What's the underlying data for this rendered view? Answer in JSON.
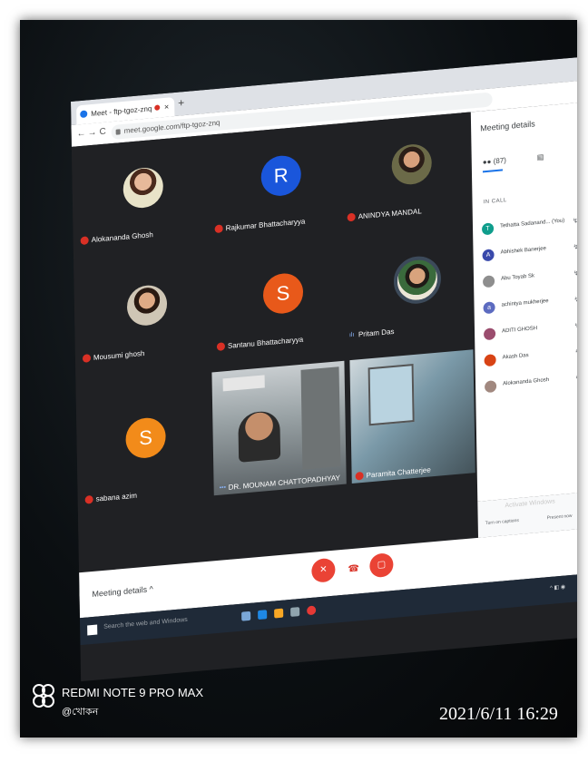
{
  "browser": {
    "tab_title": "Meet - ftp-tgoz-znq",
    "tab_close": "×",
    "new_tab": "+",
    "url": "meet.google.com/ftp-tgoz-znq",
    "nav_back": "←",
    "nav_forward": "→",
    "nav_reload": "C"
  },
  "tiles": [
    {
      "name": "Alokananda Ghosh",
      "type": "photo"
    },
    {
      "name": "Rajkumar Bhattacharyya",
      "type": "letter",
      "letter": "R",
      "color": "#1a56db"
    },
    {
      "name": "ANINDYA MANDAL",
      "type": "photo"
    },
    {
      "name": "Mousumi ghosh",
      "type": "photo"
    },
    {
      "name": "Santanu Bhattacharyya",
      "type": "letter",
      "letter": "S",
      "color": "#e8591a"
    },
    {
      "name": "Pritam Das",
      "type": "photo"
    },
    {
      "name": "sabana azim",
      "type": "letter",
      "letter": "S",
      "color": "#f28b1a"
    },
    {
      "name": "DR. MOUNAM CHATTOPADHYAY",
      "type": "video"
    },
    {
      "name": "Paramita Chatterjee",
      "type": "video"
    }
  ],
  "panel": {
    "title": "Meeting details",
    "people_count": "(87)",
    "section": "IN CALL",
    "participants": [
      {
        "name": "Tethatta Sadanand... (You)",
        "initial": "T",
        "color": "#0f9d8c"
      },
      {
        "name": "Abhishek Banerjee",
        "initial": "A",
        "color": "#3949ab"
      },
      {
        "name": "Abu Toyab Sk",
        "initial": "",
        "color": "#8e8e8e"
      },
      {
        "name": "achintya mukherjee",
        "initial": "a",
        "color": "#5c6bc0"
      },
      {
        "name": "ADITI GHOSH",
        "initial": "",
        "color": "#9b4d6e"
      },
      {
        "name": "Akash Das",
        "initial": "",
        "color": "#d84315"
      },
      {
        "name": "Alokananda Ghosh",
        "initial": "",
        "color": "#a1887f"
      }
    ],
    "activate_text": "Activate Windows",
    "captions_label": "Turn on captions",
    "present_label": "Present now"
  },
  "bottom": {
    "meeting_details": "Meeting details ^"
  },
  "taskbar": {
    "search_placeholder": "Search the web and Windows"
  },
  "watermark": {
    "model": "REDMI NOTE 9 PRO MAX",
    "user": "@খোকন",
    "timestamp": "2021/6/11 16:29"
  }
}
